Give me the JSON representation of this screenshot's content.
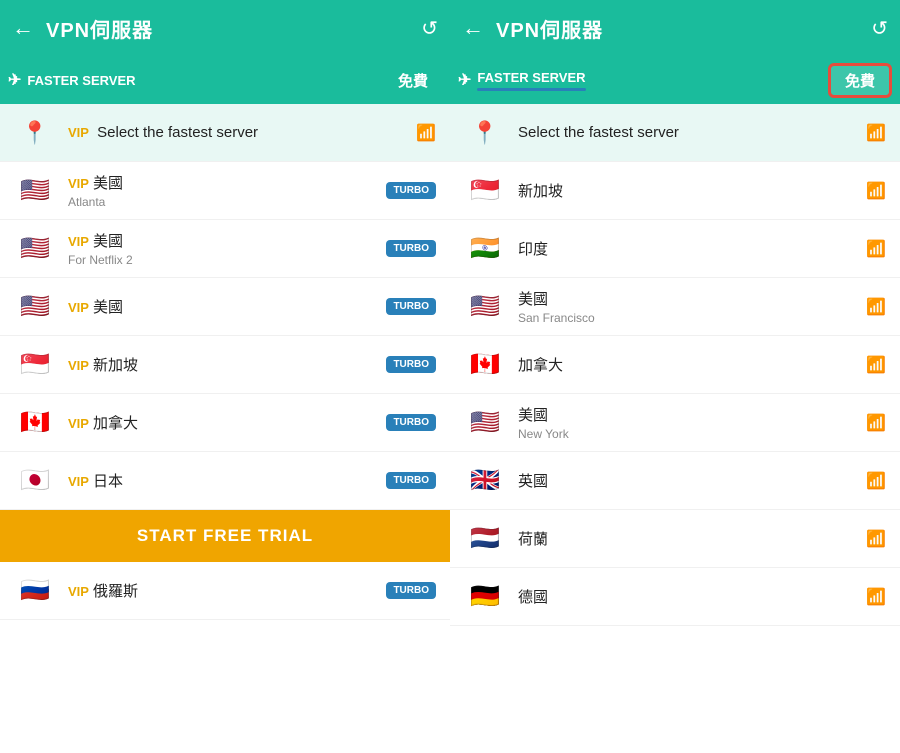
{
  "left_panel": {
    "header": {
      "title": "VPN伺服器",
      "back_label": "←",
      "refresh_label": "↺"
    },
    "tabs": {
      "faster_server_label": "FASTER SERVER",
      "free_label": "免費"
    },
    "servers": [
      {
        "id": "fastest",
        "vip": true,
        "flag": "📍",
        "flag_type": "location",
        "name": "VIP Select the fastest server",
        "sub": "",
        "badge": "signal"
      },
      {
        "id": "us-atlanta",
        "vip": true,
        "flag": "🇺🇸",
        "name": "VIP 美國",
        "sub": "Atlanta",
        "badge": "turbo"
      },
      {
        "id": "us-netflix",
        "vip": true,
        "flag": "🇺🇸",
        "name": "VIP 美國",
        "sub": "For Netflix 2",
        "badge": "turbo"
      },
      {
        "id": "us-3",
        "vip": true,
        "flag": "🇺🇸",
        "name": "VIP 美國",
        "sub": "",
        "badge": "turbo"
      },
      {
        "id": "sg-1",
        "vip": true,
        "flag": "🇸🇬",
        "name": "VIP 新加坡",
        "sub": "",
        "badge": "turbo"
      },
      {
        "id": "ca-1",
        "vip": true,
        "flag": "🇨🇦",
        "name": "VIP 加拿大",
        "sub": "",
        "badge": "turbo"
      },
      {
        "id": "jp-1",
        "vip": true,
        "flag": "🇯🇵",
        "name": "VIP 日本",
        "sub": "",
        "badge": "turbo"
      },
      {
        "id": "ru-1",
        "vip": true,
        "flag": "🇷🇺",
        "name": "VIP 俄羅斯",
        "sub": "",
        "badge": "turbo"
      }
    ],
    "trial_button": "START FREE TRIAL"
  },
  "right_panel": {
    "header": {
      "title": "VPN伺服器",
      "back_label": "←",
      "refresh_label": "↺"
    },
    "tabs": {
      "faster_server_label": "FASTER SERVER",
      "free_label": "免費"
    },
    "servers": [
      {
        "id": "fastest",
        "vip": false,
        "flag": "📍",
        "flag_type": "location",
        "name": "Select the fastest server",
        "sub": "",
        "badge": "signal"
      },
      {
        "id": "sg-free",
        "vip": false,
        "flag": "🇸🇬",
        "name": "新加坡",
        "sub": "",
        "badge": "signal"
      },
      {
        "id": "in-free",
        "vip": false,
        "flag": "🇮🇳",
        "name": "印度",
        "sub": "",
        "badge": "signal"
      },
      {
        "id": "us-sf",
        "vip": false,
        "flag": "🇺🇸",
        "name": "美國",
        "sub": "San Francisco",
        "badge": "signal"
      },
      {
        "id": "ca-free",
        "vip": false,
        "flag": "🇨🇦",
        "name": "加拿大",
        "sub": "",
        "badge": "signal"
      },
      {
        "id": "us-ny",
        "vip": false,
        "flag": "🇺🇸",
        "name": "美國",
        "sub": "New York",
        "badge": "signal"
      },
      {
        "id": "uk-free",
        "vip": false,
        "flag": "🇬🇧",
        "name": "英國",
        "sub": "",
        "badge": "signal"
      },
      {
        "id": "nl-free",
        "vip": false,
        "flag": "🇳🇱",
        "name": "荷蘭",
        "sub": "",
        "badge": "signal"
      },
      {
        "id": "de-free",
        "vip": false,
        "flag": "🇩🇪",
        "name": "德國",
        "sub": "",
        "badge": "signal"
      }
    ]
  },
  "labels": {
    "turbo": "TURBO",
    "vip": "VIP"
  }
}
